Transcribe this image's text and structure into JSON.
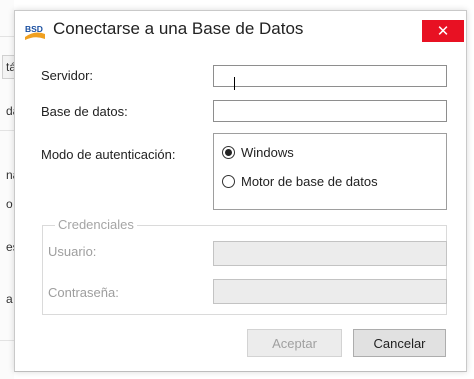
{
  "background": {
    "fragments": [
      "tá",
      "da",
      "na",
      "o",
      "es",
      "a"
    ]
  },
  "dialog": {
    "title": "Conectarse a una Base de Datos",
    "app_icon": "bsd-logo-icon",
    "app_icon_text": "BSD",
    "close_icon": "close-icon",
    "close_glyph": "✕",
    "close_color": "#e81123"
  },
  "form": {
    "server_label": "Servidor:",
    "server_value": "",
    "database_label": "Base de datos:",
    "database_value": "",
    "auth_label": "Modo de autenticación:",
    "auth_options": [
      {
        "label": "Windows",
        "selected": true
      },
      {
        "label": "Motor de base de datos",
        "selected": false
      }
    ]
  },
  "credentials": {
    "legend": "Credenciales",
    "user_label": "Usuario:",
    "user_value": "",
    "password_label": "Contraseña:",
    "password_value": ""
  },
  "buttons": {
    "accept_label": "Aceptar",
    "cancel_label": "Cancelar"
  }
}
